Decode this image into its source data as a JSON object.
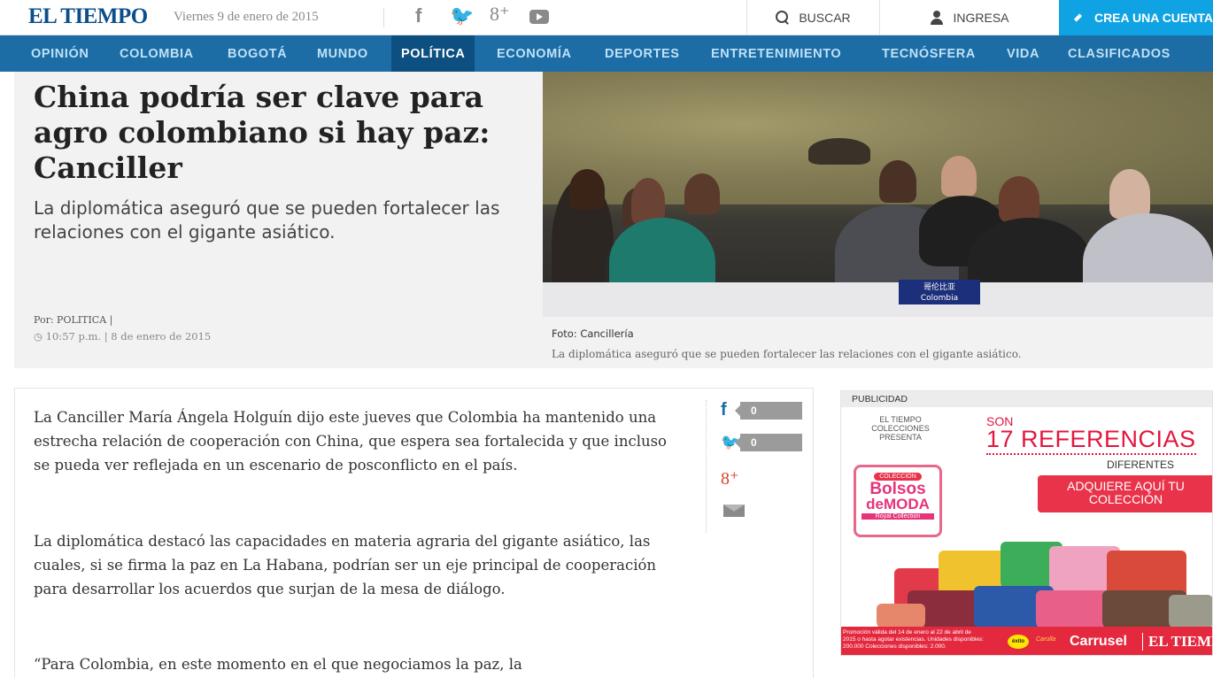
{
  "header": {
    "logo": "EL TIEMPO",
    "date": "Viernes 9 de enero de 2015",
    "social": [
      "facebook-icon",
      "twitter-icon",
      "googleplus-icon",
      "youtube-icon"
    ],
    "social_glyphs": {
      "facebook": "f",
      "twitter": "🐦",
      "googleplus": "8⁺"
    },
    "search_label": "BUSCAR",
    "login_label": "INGRESA",
    "create_label": "CREA UNA CUENTA",
    "accent_color": "#0fa3e3",
    "brand_color": "#0b4f8a"
  },
  "nav": {
    "bar_color": "#1c6ca5",
    "active_color": "#0d4f80",
    "items": [
      {
        "label": "OPINIÓN"
      },
      {
        "label": "COLOMBIA"
      },
      {
        "label": "BOGOTÁ"
      },
      {
        "label": "MUNDO"
      },
      {
        "label": "POLÍTICA",
        "active": true
      },
      {
        "label": "ECONOMÍA"
      },
      {
        "label": "DEPORTES"
      },
      {
        "label": "ENTRETENIMIENTO"
      },
      {
        "label": "TECNÓSFERA"
      },
      {
        "label": "VIDA"
      },
      {
        "label": "CLASIFICADOS"
      }
    ]
  },
  "hero": {
    "headline": "China podría ser clave para agro colombiano si hay paz: Canciller",
    "subhead": "La diplomática aseguró que se pueden fortalecer las relaciones con el gigante asiático.",
    "byline": "Por: POLITICA |",
    "time": "◷ 10:57 p.m. | 8 de enero de 2015",
    "photo_flag": "哥伦比亚",
    "photo_flag_country": "Colombia",
    "photo_credit": "Foto: Cancillería",
    "photo_caption": "La diplomática aseguró que se pueden fortalecer las relaciones con el gigante asiático."
  },
  "article": {
    "paragraphs": [
      "La Canciller María Ángela Holguín dijo este jueves que Colombia ha mantenido una estrecha relación de cooperación con China, que espera sea fortalecida y que incluso se pueda ver reflejada en un escenario de posconflicto en el país.",
      "La diplomática destacó las capacidades en materia agraria del gigante asiático, las cuales, si se firma la paz en La Habana, podrían ser un eje principal de cooperación para desarrollar los acuerdos que surjan de la mesa de diálogo.",
      "“Para Colombia, en este momento en el que negociamos la paz, la"
    ],
    "share": {
      "facebook_icon": "f",
      "facebook_count": "0",
      "twitter_icon": "🐦",
      "twitter_count": "0",
      "googleplus_icon": "8⁺"
    }
  },
  "ad": {
    "label": "PUBLICIDAD",
    "presenter": "EL TIEMPO COLECCIONES PRESENTA",
    "son": "SON",
    "count": "17 REFERENCIAS",
    "different": "DIFERENTES",
    "cta": "ADQUIERE AQUÍ TU COLECCIÓN",
    "badge_top": "COLECCIÓN",
    "badge_1": "Bolsos",
    "badge_2": "deMODA",
    "badge_brand": "Royal Collection",
    "fine_print": "Promoción válida del 14 de enero al 22 de abril de 2015 o hasta agotar existencias. Unidades disponibles: 200.000 Colecciones disponibles: 2.000.",
    "exito": "éxito",
    "carulla": "Carulla",
    "carrusel": "Carrusel",
    "eltiempo": "EL TIEMPO",
    "accent_color": "#e3163f"
  }
}
